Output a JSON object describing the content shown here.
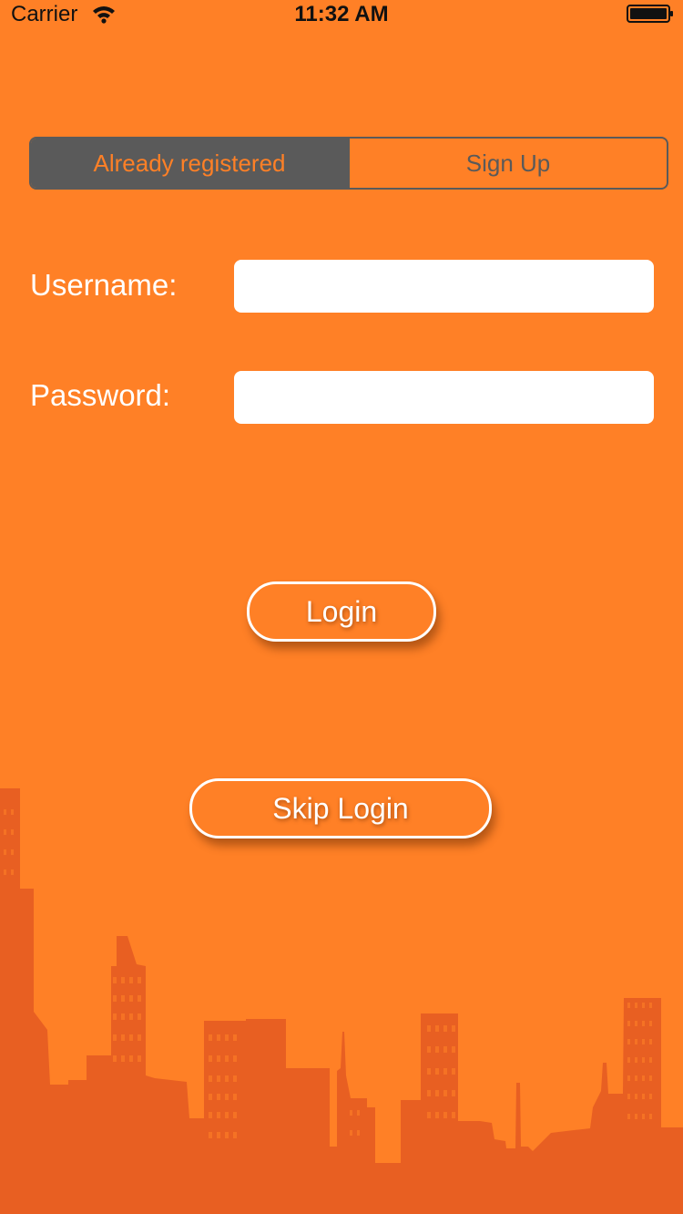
{
  "status_bar": {
    "carrier": "Carrier",
    "time": "11:32 AM",
    "wifi_icon": "wifi-icon",
    "battery_icon": "battery-icon"
  },
  "segmented_control": {
    "options": [
      {
        "label": "Already registered",
        "selected": true
      },
      {
        "label": "Sign Up",
        "selected": false
      }
    ]
  },
  "form": {
    "username_label": "Username:",
    "username_value": "",
    "password_label": "Password:",
    "password_value": ""
  },
  "buttons": {
    "login_label": "Login",
    "skip_label": "Skip Login"
  },
  "colors": {
    "background": "#FF8026",
    "skyline": "#E85F22",
    "segment_dark": "#5A5A5A",
    "text_light": "#FFFFFF"
  }
}
